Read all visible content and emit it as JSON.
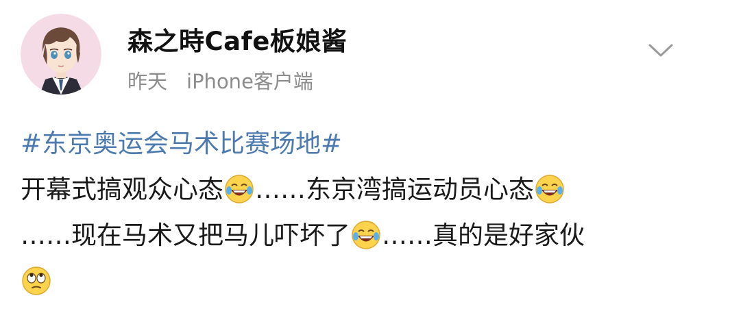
{
  "post": {
    "author": "森之時Cafe板娘酱",
    "time": "昨天",
    "source": "iPhone客户端",
    "hashtag": "#东京奥运会马术比赛场地#",
    "segments": [
      "开幕式搞观众心态",
      "……东京湾搞运动员心态",
      "……现在马术又把马儿吓坏了",
      "……真的是好家伙"
    ],
    "emojis": [
      "laughing-tears-emoji",
      "laughing-tears-emoji",
      "laughing-tears-emoji",
      "eye-roll-emoji"
    ]
  },
  "icons": {
    "menu": "chevron-down-icon"
  },
  "colors": {
    "hashtag": "#4d7bb0",
    "meta_text": "#8c8c8c",
    "body_text": "#1a1a1a"
  }
}
